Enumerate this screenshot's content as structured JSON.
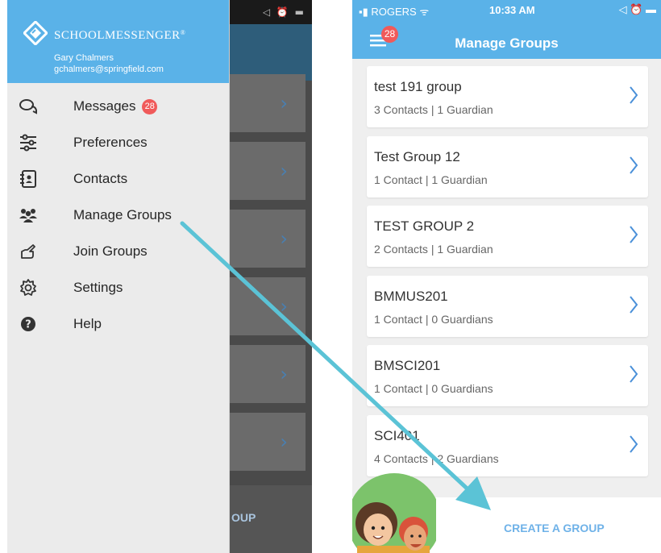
{
  "left_screen": {
    "status_icons": "◁ ⏰ ▬",
    "app_name": "SchoolMessenger",
    "brand_display": "SCHOOLMESSENGER",
    "registered_mark": "®",
    "user": {
      "name": "Gary Chalmers",
      "email": "gchalmers@springfield.com"
    },
    "menu": [
      {
        "label": "Messages",
        "icon": "chat-bubbles-icon",
        "badge": "28"
      },
      {
        "label": "Preferences",
        "icon": "sliders-icon"
      },
      {
        "label": "Contacts",
        "icon": "address-book-icon"
      },
      {
        "label": "Manage Groups",
        "icon": "people-icon"
      },
      {
        "label": "Join Groups",
        "icon": "pointing-hand-icon"
      },
      {
        "label": "Settings",
        "icon": "gear-icon"
      },
      {
        "label": "Help",
        "icon": "help-icon"
      }
    ],
    "background_footer_text": "OUP",
    "chevron": "›"
  },
  "right_screen": {
    "status": {
      "carrier": "ROGERS",
      "time": "10:33 AM",
      "icons": "◁ ⏰ ▬"
    },
    "menu_badge": "28",
    "title": "Manage Groups",
    "groups": [
      {
        "name": "test 191 group",
        "details": "3 Contacts | 1 Guardian"
      },
      {
        "name": "Test Group 12",
        "details": "1 Contact | 1 Guardian"
      },
      {
        "name": "TEST GROUP 2",
        "details": "2 Contacts | 1 Guardian"
      },
      {
        "name": "BMMUS201",
        "details": "1 Contact | 0 Guardians"
      },
      {
        "name": "BMSCI201",
        "details": "1 Contact | 0 Guardians"
      },
      {
        "name": "SCI401",
        "details": "4 Contacts | 2 Guardians"
      }
    ],
    "create_button": "CREATE A GROUP"
  },
  "colors": {
    "header_blue": "#5ab2e8",
    "badge_red": "#f05a5a",
    "chevron_blue": "#4a90d9",
    "arrow_cyan": "#5bc3d6",
    "create_text": "#6fb2e8"
  }
}
